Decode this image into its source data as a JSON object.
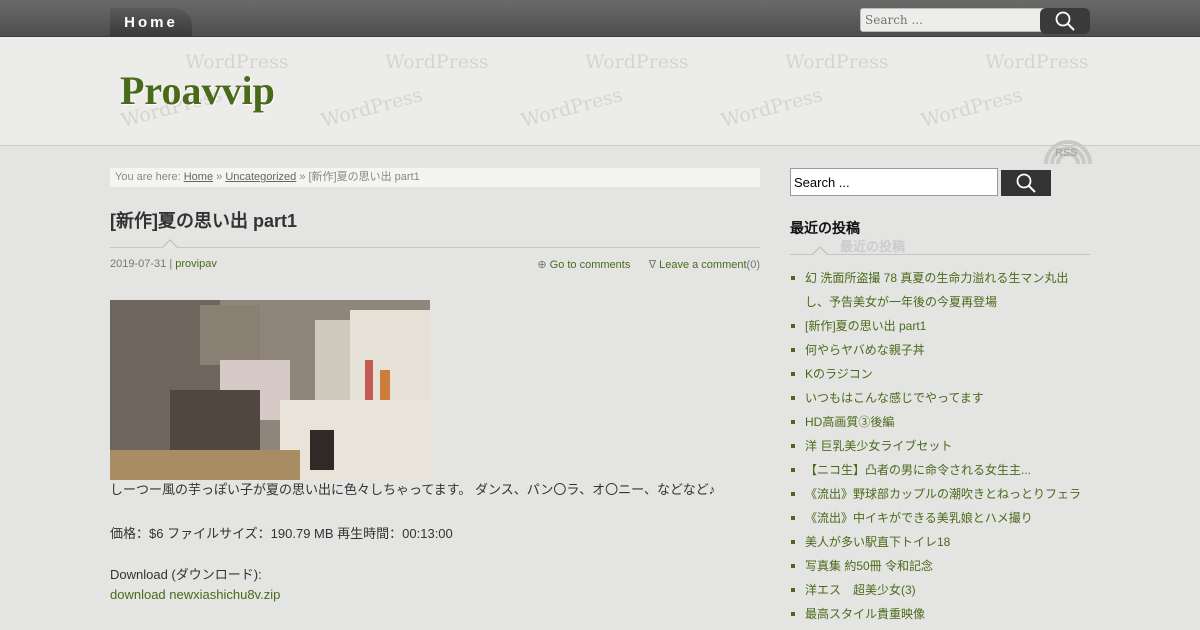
{
  "nav": {
    "home_label": "Home"
  },
  "top_search": {
    "placeholder": "Search ..."
  },
  "header": {
    "site_title": "Proavvip",
    "watermark": "WordPress",
    "rss_label": "RSS"
  },
  "breadcrumb": {
    "prefix": "You are here:",
    "home": "Home",
    "sep1": "»",
    "category": "Uncategorized",
    "sep2": "»",
    "current": "[新作]夏の思い出 part1"
  },
  "post": {
    "title": "[新作]夏の思い出 part1",
    "date": "2019-07-31",
    "meta_sep": "|",
    "author": "provipav",
    "comments_icon": "⊕",
    "go_to_comments": "Go to comments",
    "leave_icon": "∇",
    "leave_comment": "Leave a comment",
    "comment_count": "(0)",
    "description": "しーつー風の芋っぽい子が夏の思い出に色々しちゃってます。 ダンス、パン〇ラ、オ〇ニー、などなど♪",
    "info": "価格：$6 ファイルサイズ：190.79 MB 再生時間：00:13:00",
    "download_label": "Download (ダウンロード):",
    "download_link": "download newxiashichu8v.zip"
  },
  "sidebar": {
    "search_value": "Search ...",
    "widget_title": "最近の投稿",
    "recent_posts": [
      "幻 洗面所盗撮 78 真夏の生命力溢れる生マン丸出し、予告美女が一年後の今夏再登場",
      "[新作]夏の思い出 part1",
      "何やらヤバめな親子丼",
      "Kのラジコン",
      "いつもはこんな感じでやってます",
      "HD高画質③後編",
      "洋 巨乳美少女ライブセット",
      "【ニコ生】凸者の男に命令される女生主...",
      "《流出》野球部カップルの潮吹きとねっとりフェラ",
      "《流出》中イキができる美乳娘とハメ撮り",
      "美人が多い駅直下トイレ18",
      "写真集 約50冊 令和記念",
      "洋エス　超美少女(3)",
      "最高スタイル貴重映像"
    ]
  },
  "colors": {
    "accent": "#4a6a1a",
    "topbar": "#585858"
  }
}
